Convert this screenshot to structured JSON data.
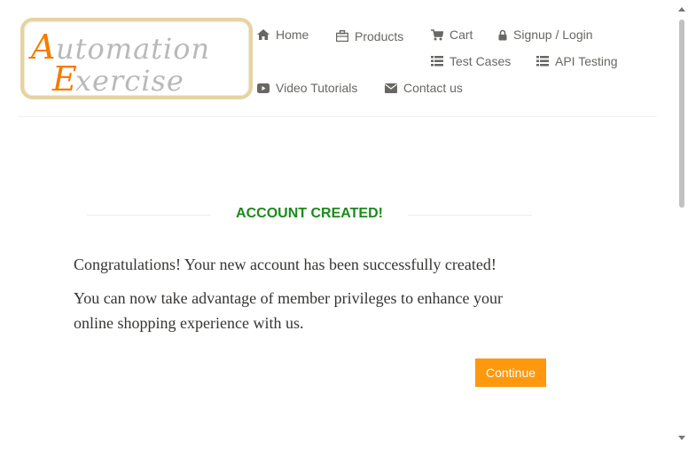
{
  "logo": {
    "line1_first": "A",
    "line1_rest": "utomation",
    "line2_first": "E",
    "line2_rest": "xercise"
  },
  "nav": {
    "home": "Home",
    "products": "Products",
    "cart": "Cart",
    "signup_login": "Signup / Login",
    "test_cases": "Test Cases",
    "api_testing": "API Testing",
    "video_tutorials": "Video Tutorials",
    "contact_us": "Contact us"
  },
  "main": {
    "title": "ACCOUNT CREATED!",
    "message1": "Congratulations! Your new account has been successfully created!",
    "message2_line1": "You can now take advantage of member privileges to enhance your",
    "message2_line2": "online shopping experience with us.",
    "continue_label": "Continue"
  },
  "colors": {
    "accent": "#fe980f",
    "success": "#1b8a1b",
    "nav_text": "#696763"
  },
  "icons": {
    "home": "home-icon",
    "products": "briefcase-icon",
    "cart": "cart-icon",
    "login": "lock-icon",
    "test_cases": "list-icon",
    "api_testing": "list-icon",
    "video": "youtube-play-icon",
    "contact": "envelope-icon"
  }
}
